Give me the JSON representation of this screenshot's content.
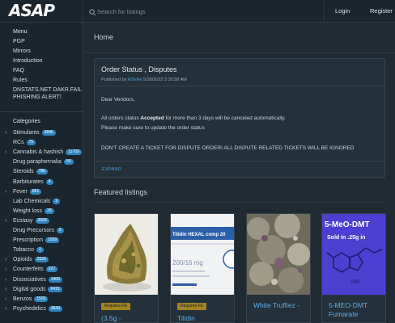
{
  "header": {
    "logo_text": "ASAP",
    "search_placeholder": "Search for listings",
    "login": "Login",
    "register": "Register"
  },
  "sidebar": {
    "menu_title": "Menu",
    "menu": [
      "PGP",
      "Mirrors",
      "Introduction",
      "FAQ",
      "Rules",
      "DNSTATS.NET DAKR.FAIL PHISHING ALERT!"
    ],
    "categories_title": "Categories",
    "categories": [
      {
        "label": "Stimulants",
        "count": "5846",
        "expandable": true
      },
      {
        "label": "RCs",
        "count": "75",
        "expandable": false
      },
      {
        "label": "Cannabis & hashish",
        "count": "11709",
        "expandable": true
      },
      {
        "label": "Drug paraphernalia",
        "count": "50",
        "expandable": false
      },
      {
        "label": "Steroids",
        "count": "786",
        "expandable": false
      },
      {
        "label": "Barbiturates",
        "count": "4",
        "expandable": false
      },
      {
        "label": "Fever",
        "count": "861",
        "expandable": true
      },
      {
        "label": "Lab Chemicals",
        "count": "9",
        "expandable": false
      },
      {
        "label": "Weight loss",
        "count": "28",
        "expandable": false
      },
      {
        "label": "Ecstasy",
        "count": "2609",
        "expandable": true
      },
      {
        "label": "Drug Precursors",
        "count": "5",
        "expandable": false
      },
      {
        "label": "Prescription",
        "count": "1559",
        "expandable": false
      },
      {
        "label": "Tobacco",
        "count": "1",
        "expandable": false
      },
      {
        "label": "Opioids",
        "count": "2525",
        "expandable": true
      },
      {
        "label": "Counterfeits",
        "count": "227",
        "expandable": true
      },
      {
        "label": "Dissociatives",
        "count": "1409",
        "expandable": true
      },
      {
        "label": "Digital goods",
        "count": "6415",
        "expandable": true
      },
      {
        "label": "Benzos",
        "count": "1505",
        "expandable": true
      },
      {
        "label": "Psychedelics",
        "count": "3649",
        "expandable": true
      }
    ]
  },
  "breadcrumb": {
    "home": "Home"
  },
  "notice": {
    "title": "Order Status , Disputes",
    "published_by": "Published by",
    "author": "AStrike",
    "date": "5/28/2022 2:35:58 AM",
    "greeting": "Dear Vendors,",
    "line1_pre": "All orders status ",
    "line1_bold": "Accepted",
    "line1_post": " for more than 3 days will be canceled automatically.",
    "line2": "Please make sure to update the order status",
    "line3": "DON'T CREATE A TICKET FOR DISPUTE ORDER! ALL DISPUTE RELATED TICKETS WILL BE IGNORED",
    "expand": "EXPAND"
  },
  "featured": {
    "title": "Featured listings",
    "items": [
      {
        "badge": "Requires FE",
        "name": "(3.5g -",
        "image": "cannabis-bud-photo"
      },
      {
        "badge": "Requires FE",
        "name": "Tilidin",
        "image": "tilidin-box-photo",
        "image_text_1": "Tilidin HEXAL comp 20",
        "image_text_2": "200/16 mg"
      },
      {
        "badge": "",
        "name": "White Truffiez -",
        "image": "cannabis-closeup-photo"
      },
      {
        "badge": "",
        "name": "5-MEO-DMT Fumarate",
        "image": "molecule-structure-image",
        "image_text_1": "5-MeO-DMT",
        "image_text_2": "Sold in .25g in",
        "image_text_3": "HN"
      }
    ]
  },
  "colors": {
    "accent": "#2e86c1",
    "link": "#5ab0e8",
    "badge": "#a08421",
    "background": "#1f2a33"
  }
}
